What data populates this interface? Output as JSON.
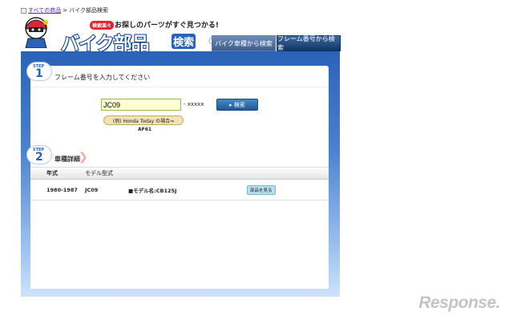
{
  "breadcrumb": {
    "link": "すべての商品",
    "sep": ">",
    "current": "バイク部品検索"
  },
  "header": {
    "badge": "検索楽々",
    "tagline": "お探しのパーツがすぐ見つかる!",
    "logo_main": "バイク部品",
    "logo_suffix": "検索"
  },
  "tabs": [
    {
      "label": "バイク車種から検索"
    },
    {
      "label": "フレーム番号から検索"
    }
  ],
  "step1": {
    "step_word": "STEP",
    "step_num": "1",
    "label": "フレーム番号を入力してください",
    "input_value": "JC09",
    "suffix": "- xxxxx",
    "search_label": "▸ 検索",
    "example_label": "(例) Honda Today の場合⇒",
    "example_value": "AF61"
  },
  "step2": {
    "step_word": "STEP",
    "step_num": "2",
    "title": "車種詳細",
    "columns": [
      "年式",
      "モデル型式"
    ],
    "rows": [
      {
        "year": "1980-1987",
        "code": "JC09",
        "model": "■モデル名:CB125J",
        "button": "部品を見る"
      }
    ]
  },
  "watermark": "Response."
}
